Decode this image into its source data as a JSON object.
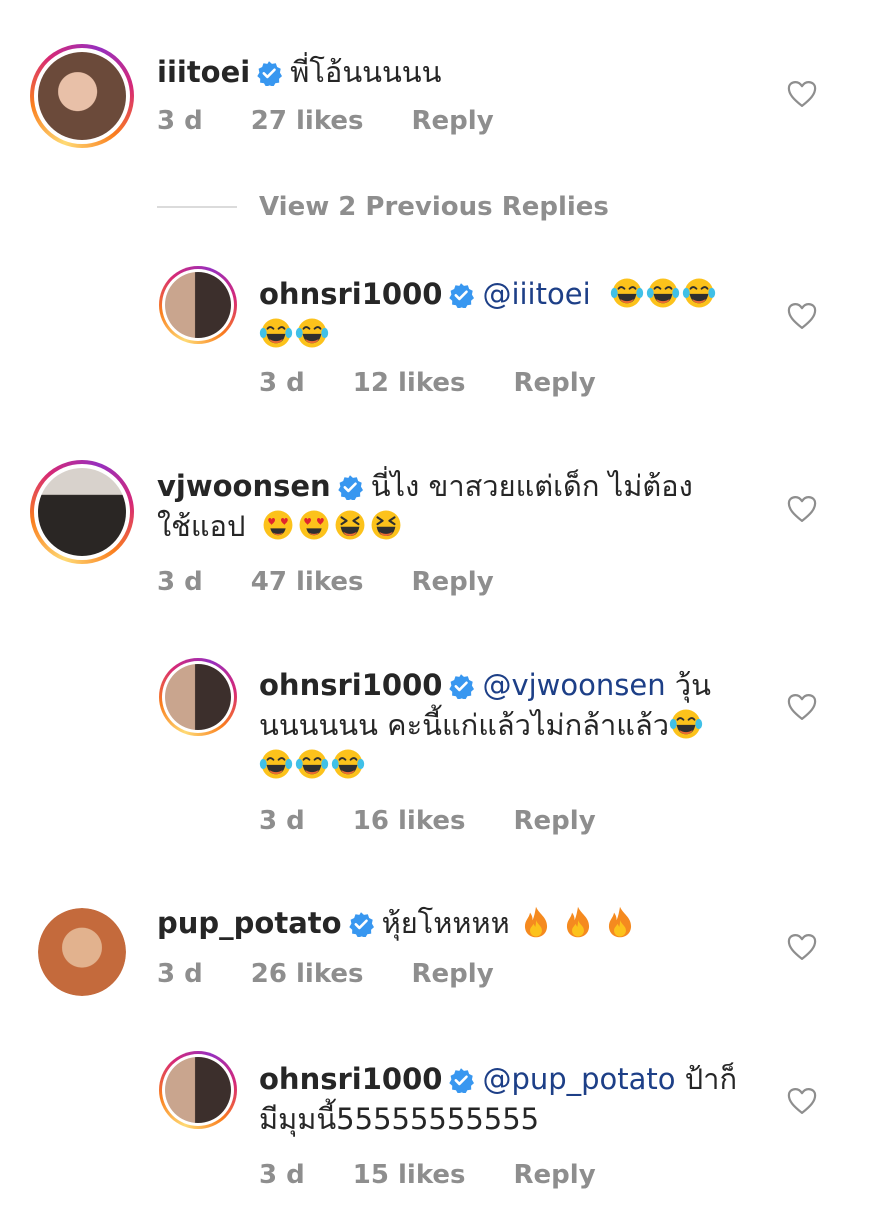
{
  "comments": [
    {
      "username": "iiitoei",
      "text": "พี่โอ้นนนนน",
      "time": "3 d",
      "likes": "27 likes",
      "reply": "Reply"
    },
    {
      "view_previous": "View 2 Previous Replies"
    },
    {
      "username": "ohnsri1000",
      "mention": "@iiitoei",
      "text": "",
      "time": "3 d",
      "likes": "12 likes",
      "reply": "Reply"
    },
    {
      "username": "vjwoonsen",
      "text1": "นี่ไง ขาสวยแต่เด็ก ไม่ต้อง",
      "text2": "ใช้แอป",
      "time": "3 d",
      "likes": "47 likes",
      "reply": "Reply"
    },
    {
      "username": "ohnsri1000",
      "mention": "@vjwoonsen",
      "text1": "วุ้น",
      "text2": "นนนนนน คะนี้แก่แล้วไม่กล้าแล้ว",
      "time": "3 d",
      "likes": "16 likes",
      "reply": "Reply"
    },
    {
      "username": "pup_potato",
      "text": "หุ้ยโหหหห",
      "time": "3 d",
      "likes": "26 likes",
      "reply": "Reply"
    },
    {
      "username": "ohnsri1000",
      "mention": "@pup_potato",
      "text1": "ป้าก็",
      "text2": "มีมุมนี้55555555555",
      "time": "3 d",
      "likes": "15 likes",
      "reply": "Reply"
    }
  ],
  "icons": {
    "verified": "verified-badge-icon",
    "heart": "heart-outline-icon",
    "laugh": "tears-of-joy-emoji",
    "hearteyes": "heart-eyes-emoji",
    "squint": "squinting-laugh-emoji",
    "fire": "fire-emoji"
  },
  "colors": {
    "verified": "#3897f0",
    "mention": "#1d3f87",
    "meta": "#8e8e8e"
  }
}
